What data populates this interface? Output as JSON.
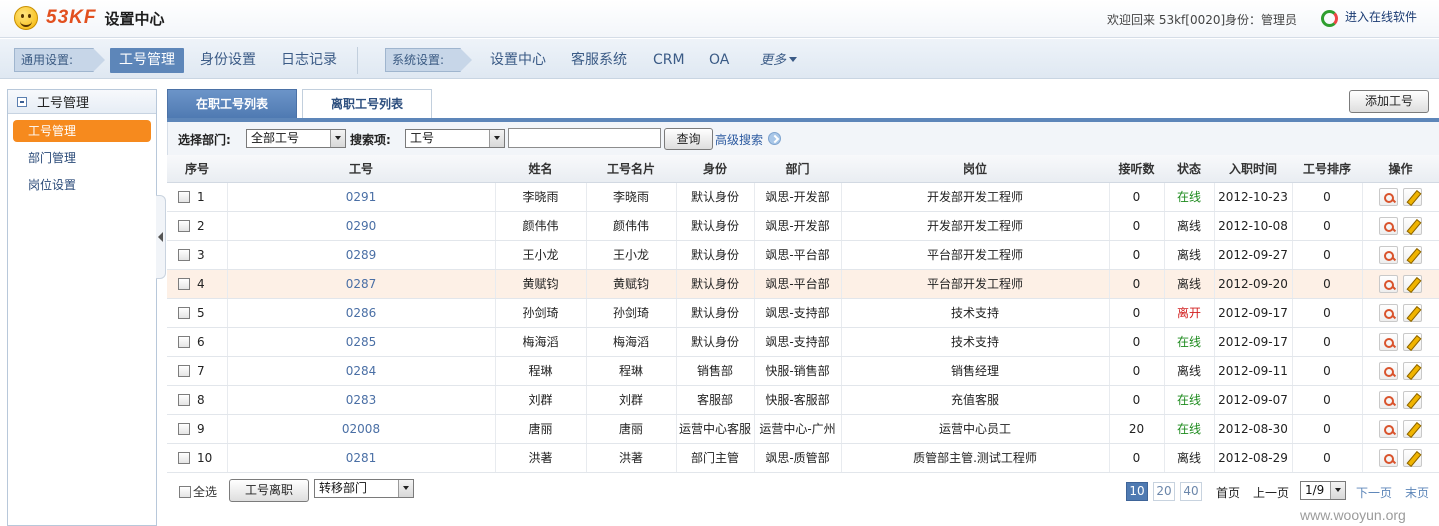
{
  "header": {
    "brand": "53KF",
    "title": "设置中心",
    "welcome": "欢迎回来 53kf[0020]",
    "role": "身份：管理员",
    "online_label": "进入在线软件"
  },
  "nav": {
    "general_tag": "通用设置:",
    "general_items": [
      "工号管理",
      "身份设置",
      "日志记录"
    ],
    "system_tag": "系统设置:",
    "system_items": [
      "设置中心",
      "客服系统",
      "CRM",
      "OA"
    ],
    "more": "更多"
  },
  "sidebar": {
    "title": "工号管理",
    "items": [
      "工号管理",
      "部门管理",
      "岗位设置"
    ]
  },
  "tabs": {
    "active": "在职工号列表",
    "inactive": "离职工号列表",
    "add_button": "添加工号"
  },
  "search": {
    "dept_label": "选择部门:",
    "dept_value": "全部工号",
    "field_label": "搜索项:",
    "field_value": "工号",
    "input_value": "",
    "query_button": "查询",
    "advanced": "高级搜索"
  },
  "table": {
    "columns": [
      "序号",
      "工号",
      "姓名",
      "工号名片",
      "身份",
      "部门",
      "岗位",
      "接听数",
      "状态",
      "入职时间",
      "工号排序",
      "操作"
    ],
    "rows": [
      {
        "seq": "1",
        "id": "0291",
        "name": "李晓雨",
        "card": "李晓雨",
        "role": "默认身份",
        "dept": "飒思-开发部",
        "post": "开发部开发工程师",
        "calls": "0",
        "status": "在线",
        "date": "2012-10-23",
        "order": "0"
      },
      {
        "seq": "2",
        "id": "0290",
        "name": "颜伟伟",
        "card": "颜伟伟",
        "role": "默认身份",
        "dept": "飒思-开发部",
        "post": "开发部开发工程师",
        "calls": "0",
        "status": "离线",
        "date": "2012-10-08",
        "order": "0"
      },
      {
        "seq": "3",
        "id": "0289",
        "name": "王小龙",
        "card": "王小龙",
        "role": "默认身份",
        "dept": "飒思-平台部",
        "post": "平台部开发工程师",
        "calls": "0",
        "status": "离线",
        "date": "2012-09-27",
        "order": "0"
      },
      {
        "seq": "4",
        "id": "0287",
        "name": "黄赋钧",
        "card": "黄赋钧",
        "role": "默认身份",
        "dept": "飒思-平台部",
        "post": "平台部开发工程师",
        "calls": "0",
        "status": "离线",
        "date": "2012-09-20",
        "order": "0"
      },
      {
        "seq": "5",
        "id": "0286",
        "name": "孙剑琦",
        "card": "孙剑琦",
        "role": "默认身份",
        "dept": "飒思-支持部",
        "post": "技术支持",
        "calls": "0",
        "status": "离开",
        "date": "2012-09-17",
        "order": "0"
      },
      {
        "seq": "6",
        "id": "0285",
        "name": "梅海滔",
        "card": "梅海滔",
        "role": "默认身份",
        "dept": "飒思-支持部",
        "post": "技术支持",
        "calls": "0",
        "status": "在线",
        "date": "2012-09-17",
        "order": "0"
      },
      {
        "seq": "7",
        "id": "0284",
        "name": "程琳",
        "card": "程琳",
        "role": "销售部",
        "dept": "快服-销售部",
        "post": "销售经理",
        "calls": "0",
        "status": "离线",
        "date": "2012-09-11",
        "order": "0"
      },
      {
        "seq": "8",
        "id": "0283",
        "name": "刘群",
        "card": "刘群",
        "role": "客服部",
        "dept": "快服-客服部",
        "post": "充值客服",
        "calls": "0",
        "status": "在线",
        "date": "2012-09-07",
        "order": "0"
      },
      {
        "seq": "9",
        "id": "02008",
        "name": "唐丽",
        "card": "唐丽",
        "role": "运营中心客服",
        "dept": "运营中心-广州",
        "post": "运营中心员工",
        "calls": "20",
        "status": "在线",
        "date": "2012-08-30",
        "order": "0"
      },
      {
        "seq": "10",
        "id": "0281",
        "name": "洪著",
        "card": "洪著",
        "role": "部门主管",
        "dept": "飒思-质管部",
        "post": "质管部主管.测试工程师",
        "calls": "0",
        "status": "离线",
        "date": "2012-08-29",
        "order": "0"
      }
    ]
  },
  "footer": {
    "select_all": "全选",
    "leave_button": "工号离职",
    "transfer_select": "转移部门",
    "page_sizes": [
      "10",
      "20",
      "40"
    ],
    "first": "首页",
    "prev": "上一页",
    "page_value": "1/9",
    "next": "下一页",
    "last": "末页"
  },
  "watermark": "www.wooyun.org",
  "colors": {
    "accent": "#5d86b9",
    "sidebar_active": "#f68a1e",
    "status_online": "#1e8b1e",
    "status_away": "#d21f1f"
  }
}
